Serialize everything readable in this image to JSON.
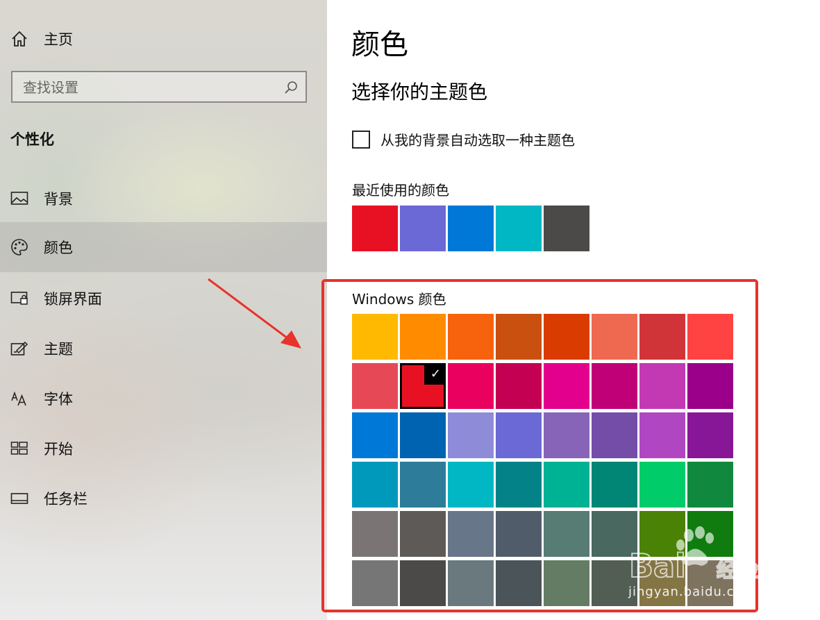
{
  "sidebar": {
    "home_label": "主页",
    "search_placeholder": "查找设置",
    "section_title": "个性化",
    "items": [
      {
        "label": "背景",
        "icon": "picture-icon"
      },
      {
        "label": "颜色",
        "icon": "palette-icon"
      },
      {
        "label": "锁屏界面",
        "icon": "lock-screen-icon"
      },
      {
        "label": "主题",
        "icon": "theme-icon"
      },
      {
        "label": "字体",
        "icon": "font-icon"
      },
      {
        "label": "开始",
        "icon": "start-icon"
      },
      {
        "label": "任务栏",
        "icon": "taskbar-icon"
      }
    ],
    "selected_item": "颜色"
  },
  "main": {
    "title": "颜色",
    "subtitle": "选择你的主题色",
    "auto_pick_label": "从我的背景自动选取一种主题色",
    "auto_pick_checked": false,
    "recent_label": "最近使用的颜色",
    "recent_colors": [
      "#e81123",
      "#6b69d6",
      "#0078d7",
      "#00b7c3",
      "#4c4a48"
    ],
    "windows_label": "Windows 颜色",
    "windows_colors": [
      [
        "#ffb900",
        "#ff8c00",
        "#f7630c",
        "#ca5010",
        "#da3b01",
        "#ef6950",
        "#d13438",
        "#ff4343"
      ],
      [
        "#e74856",
        "#e81123",
        "#ea005e",
        "#c30052",
        "#e3008c",
        "#bf0077",
        "#c239b3",
        "#9a0089"
      ],
      [
        "#0078d7",
        "#0063b1",
        "#8e8cd8",
        "#6b69d6",
        "#8764b8",
        "#744da9",
        "#b146c2",
        "#881798"
      ],
      [
        "#0099bc",
        "#2d7d9a",
        "#00b7c3",
        "#038387",
        "#00b294",
        "#018574",
        "#00cc6a",
        "#10893e"
      ],
      [
        "#7a7574",
        "#5d5a58",
        "#68768a",
        "#515c6b",
        "#567c73",
        "#486860",
        "#498205",
        "#107c10"
      ],
      [
        "#767676",
        "#4c4a48",
        "#69797e",
        "#4a5459",
        "#647c64",
        "#525e54",
        "#847545",
        "#7e735f"
      ]
    ],
    "selected_color": "#e81123",
    "check_glyph": "✓"
  },
  "watermark": {
    "brand": "Bai du 经验",
    "url": "jingyan.baidu.com"
  },
  "accent": "#e8322c"
}
